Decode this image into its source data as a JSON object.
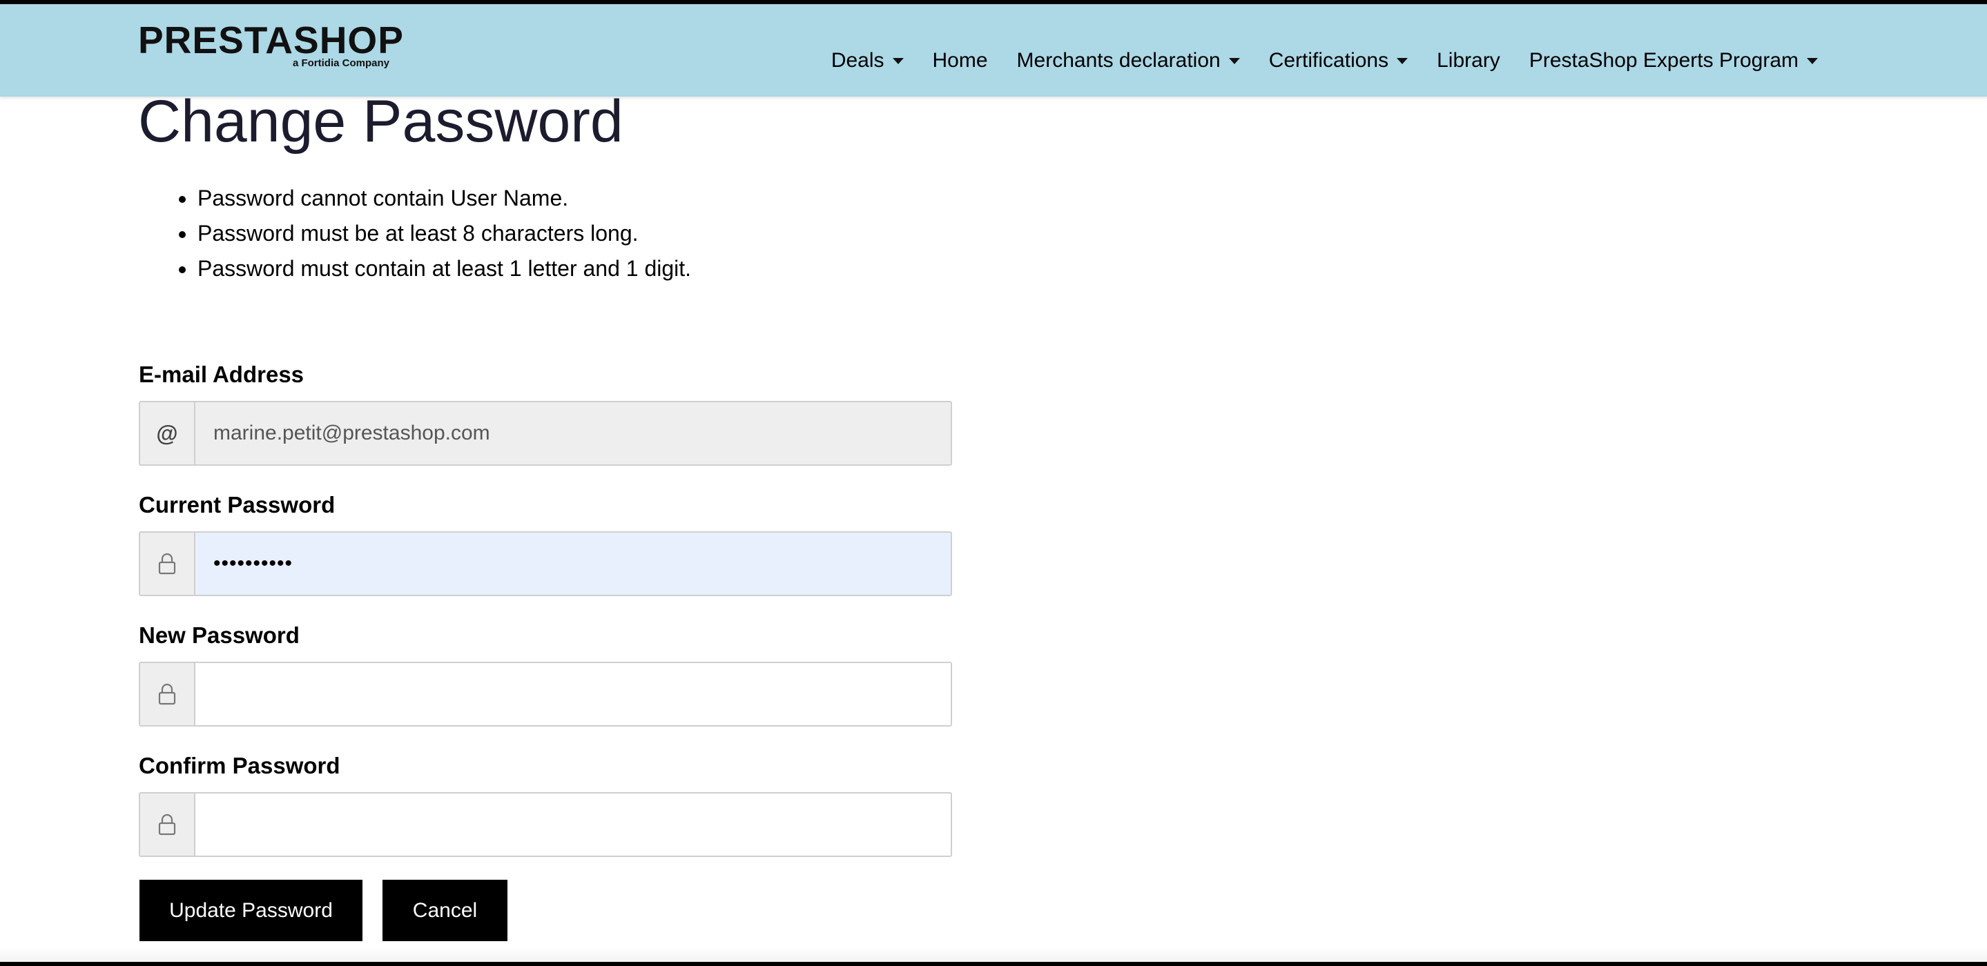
{
  "brand": {
    "name": "PRESTASHOP",
    "tagline": "a Fortidia Company"
  },
  "nav": {
    "items": [
      {
        "label": "Deals",
        "dropdown": true
      },
      {
        "label": "Home",
        "dropdown": false
      },
      {
        "label": "Merchants declaration",
        "dropdown": true
      },
      {
        "label": "Certifications",
        "dropdown": true
      },
      {
        "label": "Library",
        "dropdown": false
      },
      {
        "label": "PrestaShop Experts Program",
        "dropdown": true
      }
    ]
  },
  "page": {
    "title": "Change Password",
    "rules": [
      "Password cannot contain User Name.",
      "Password must be at least 8 characters long.",
      "Password must contain at least 1 letter and 1 digit."
    ]
  },
  "form": {
    "email": {
      "label": "E-mail Address",
      "addon": "@",
      "value": "marine.petit@prestashop.com"
    },
    "current_password": {
      "label": "Current Password",
      "value": "••••••••••"
    },
    "new_password": {
      "label": "New Password",
      "value": ""
    },
    "confirm_password": {
      "label": "Confirm Password",
      "value": ""
    }
  },
  "buttons": {
    "update": "Update Password",
    "cancel": "Cancel"
  },
  "colors": {
    "navbar": "#add8e6",
    "button": "#000000",
    "autofill": "#e8f0fe"
  }
}
